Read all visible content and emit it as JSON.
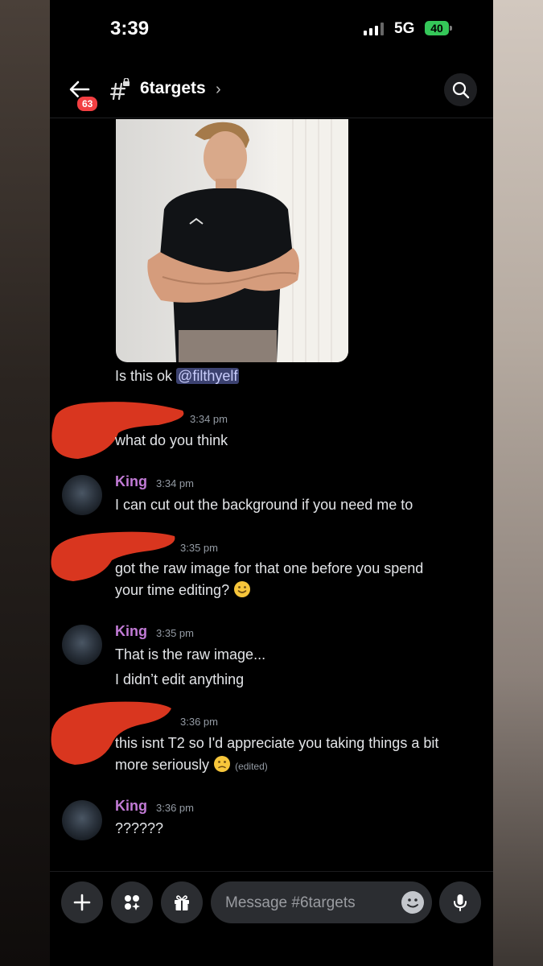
{
  "status_bar": {
    "time": "3:39",
    "network": "5G",
    "battery": "40"
  },
  "header": {
    "unread_count": "63",
    "channel_name": "6targets"
  },
  "messages": [
    {
      "text": "Is this ok",
      "mention": "@filthyelf"
    },
    {
      "timestamp": "3:34 pm",
      "lines": [
        "what do you think"
      ]
    },
    {
      "author": "King",
      "timestamp": "3:34 pm",
      "lines": [
        "I can cut out the background if you need me to"
      ]
    },
    {
      "timestamp": "3:35 pm",
      "lines": [
        "got the raw image for that one before you spend",
        "your time editing?"
      ]
    },
    {
      "author": "King",
      "timestamp": "3:35 pm",
      "lines": [
        "That is the raw image...",
        "I didn’t edit anything"
      ]
    },
    {
      "timestamp": "3:36 pm",
      "lines": [
        "this isnt T2 so I'd appreciate you taking things a bit",
        "more seriously"
      ],
      "edited_label": "(edited)"
    },
    {
      "author": "King",
      "timestamp": "3:36 pm",
      "lines": [
        "??????"
      ]
    }
  ],
  "composer": {
    "placeholder": "Message #6targets"
  },
  "colors": {
    "background": "#000000",
    "username": "#c27bd6",
    "mention_bg": "#3c4270",
    "redaction": "#d9361f"
  }
}
